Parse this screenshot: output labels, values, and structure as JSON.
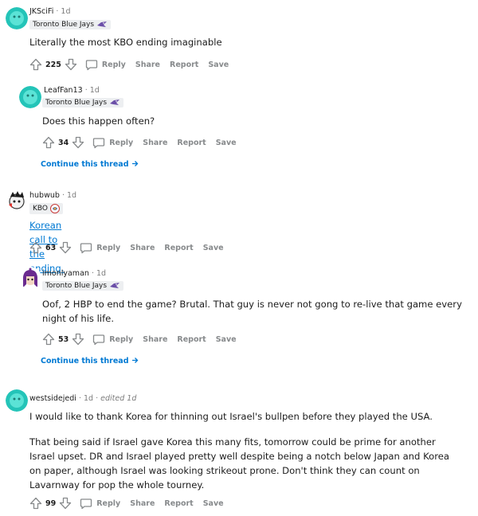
{
  "comments": [
    {
      "username": "JKSciFi",
      "age": "· 1d",
      "flair": "Toronto Blue Jays",
      "body": "Literally the most KBO ending imaginable",
      "votes": "225",
      "reply": "Reply",
      "share": "Share",
      "report": "Report",
      "save": "Save"
    },
    {
      "username": "LeafFan13",
      "age": "· 1d",
      "flair": "Toronto Blue Jays",
      "body": "Does this happen often?",
      "votes": "34",
      "reply": "Reply",
      "share": "Share",
      "report": "Report",
      "save": "Save",
      "continue": "Continue this thread"
    },
    {
      "username": "hubwub",
      "age": "· 1d",
      "flair": "KBO",
      "body": "Korean call to the ending.",
      "votes": "63",
      "reply": "Reply",
      "share": "Share",
      "report": "Report",
      "save": "Save"
    },
    {
      "username": "imonlyaman",
      "age": "· 1d",
      "flair": "Toronto Blue Jays",
      "body": "Oof, 2 HBP to end the game? Brutal. That guy is never not gong to re-live that game every night of his life.",
      "votes": "53",
      "reply": "Reply",
      "share": "Share",
      "report": "Report",
      "save": "Save",
      "continue": "Continue this thread"
    },
    {
      "username": "westsidejedi",
      "age": "· 1d ·",
      "edited": "edited 1d",
      "body": "I would like to thank Korea for thinning out Israel's bullpen before they played the USA.",
      "body2": "That being said if Israel gave Korea this many fits, tomorrow could be prime for another Israel upset. DR and Israel played pretty well despite being a notch below Japan and Korea on paper, although Israel was looking strikeout prone. Don't think they can count on Lavarnway for pop the whole tourney.",
      "votes": "99",
      "reply": "Reply",
      "share": "Share",
      "report": "Report",
      "save": "Save"
    }
  ],
  "colors": {
    "link": "#0079d3",
    "meta": "#7c7c7c",
    "action": "#878a8c",
    "avatar_teal": "#24c4b8"
  },
  "icons": [
    "upvote-icon",
    "downvote-icon",
    "reply-icon",
    "chevron-right-icon",
    "blue-jays-flair-icon",
    "kbo-flair-icon"
  ]
}
